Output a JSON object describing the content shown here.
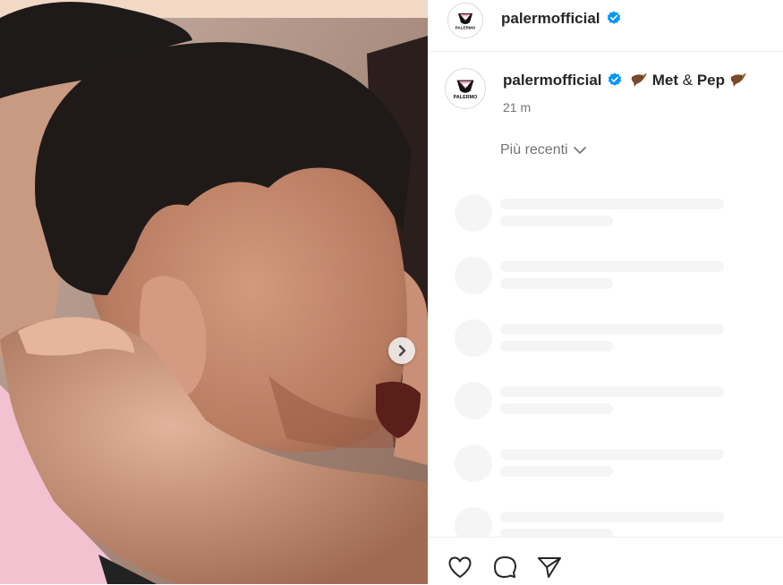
{
  "post": {
    "username": "palermofficial",
    "verified": true,
    "caption_part1": "Met",
    "caption_amp": "&",
    "caption_part2": "Pep",
    "timestamp": "21 m",
    "comments_sort": "Più recenti",
    "avatar_text": "PALERMO"
  },
  "icons": {
    "verified": "verified-badge-icon",
    "bird": "eagle-emoji-icon",
    "next": "chevron-right-icon",
    "sort": "chevron-down-icon",
    "like": "heart-icon",
    "comment": "comment-bubble-icon",
    "share": "paper-plane-icon"
  },
  "colors": {
    "verified": "#0095f6",
    "text": "#262626",
    "secondary": "#737373",
    "skeleton": "#f5f5f5",
    "brand_pink": "#f4a6c3"
  }
}
